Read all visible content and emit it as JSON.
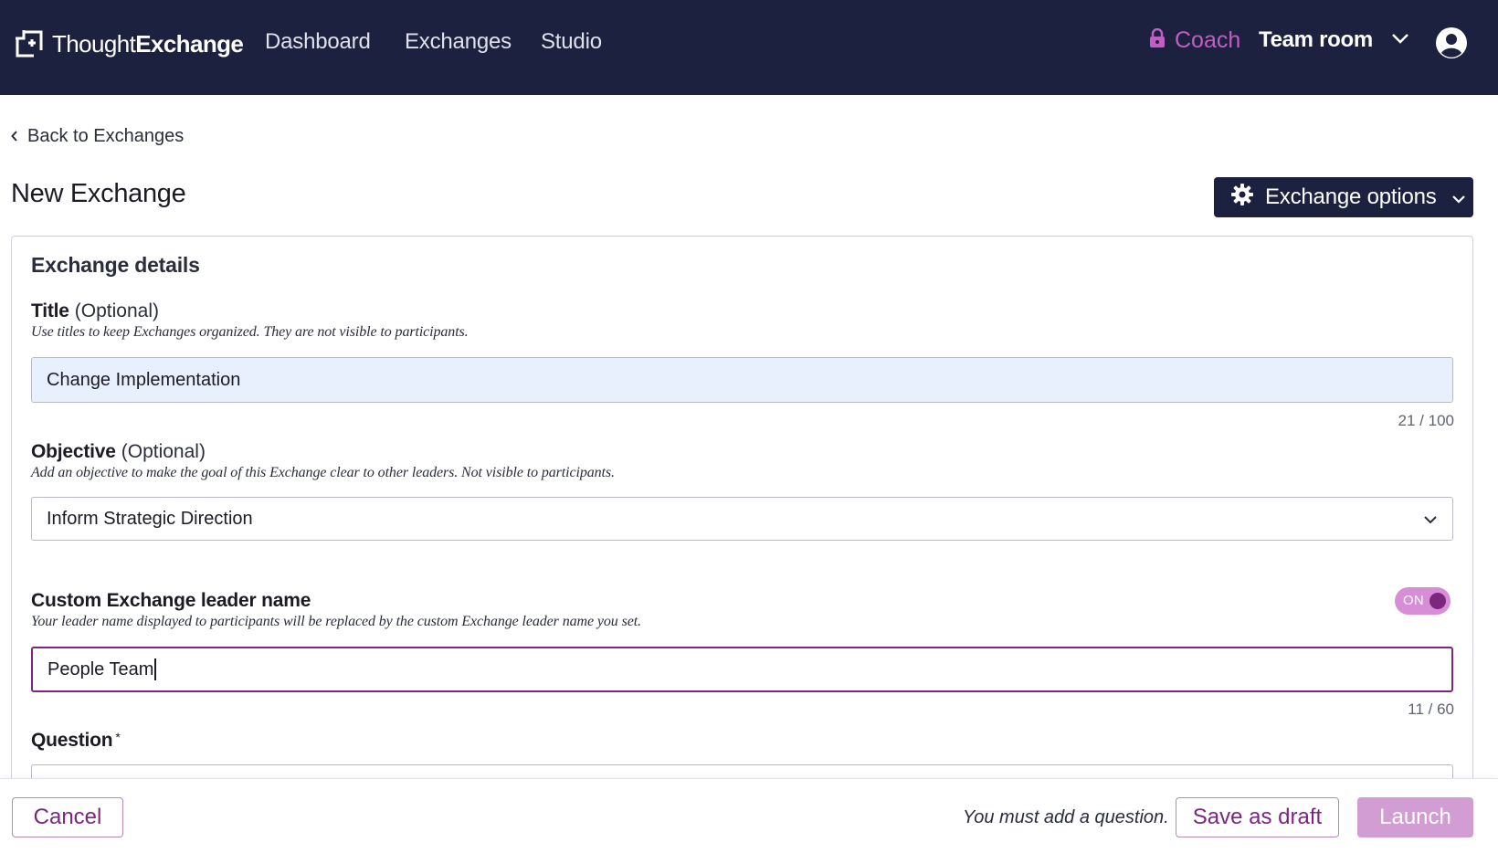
{
  "header": {
    "logo_text_light": "Thought",
    "logo_text_bold": "Exchange",
    "nav": [
      {
        "label": "Dashboard"
      },
      {
        "label": "Exchanges"
      },
      {
        "label": "Studio"
      }
    ],
    "coach_label": "Coach",
    "team_room_label": "Team room",
    "icons": [
      "logo-icon",
      "lock-icon",
      "chevron-down-icon",
      "account-icon"
    ],
    "colors": {
      "bar": "#1c2140",
      "coach": "#c25ec2"
    }
  },
  "page": {
    "back_label": "Back to Exchanges",
    "title": "New Exchange",
    "options_button_label": "Exchange options"
  },
  "card": {
    "title": "Exchange details",
    "title_field": {
      "label": "Title",
      "optional": "(Optional)",
      "help": "Use titles to keep Exchanges organized. They are not visible to participants.",
      "value": "Change Implementation",
      "counter": "21 / 100"
    },
    "objective_field": {
      "label": "Objective",
      "optional": "(Optional)",
      "help": "Add an objective to make the goal of this Exchange clear to other leaders. Not visible to participants.",
      "selected": "Inform Strategic Direction"
    },
    "leader_field": {
      "label": "Custom Exchange leader name",
      "help": "Your leader name displayed to participants will be replaced by the custom Exchange leader name you set.",
      "toggle_label": "ON",
      "toggle_on": true,
      "value": "People Team",
      "counter": "11 / 60"
    },
    "question_field": {
      "label": "Question",
      "required_mark": "*"
    }
  },
  "footer": {
    "cancel_label": "Cancel",
    "validation_message": "You must add a question.",
    "draft_label": "Save as draft",
    "launch_label": "Launch",
    "colors": {
      "accent": "#7b2780",
      "launch_disabled": "#d19dd3"
    }
  }
}
